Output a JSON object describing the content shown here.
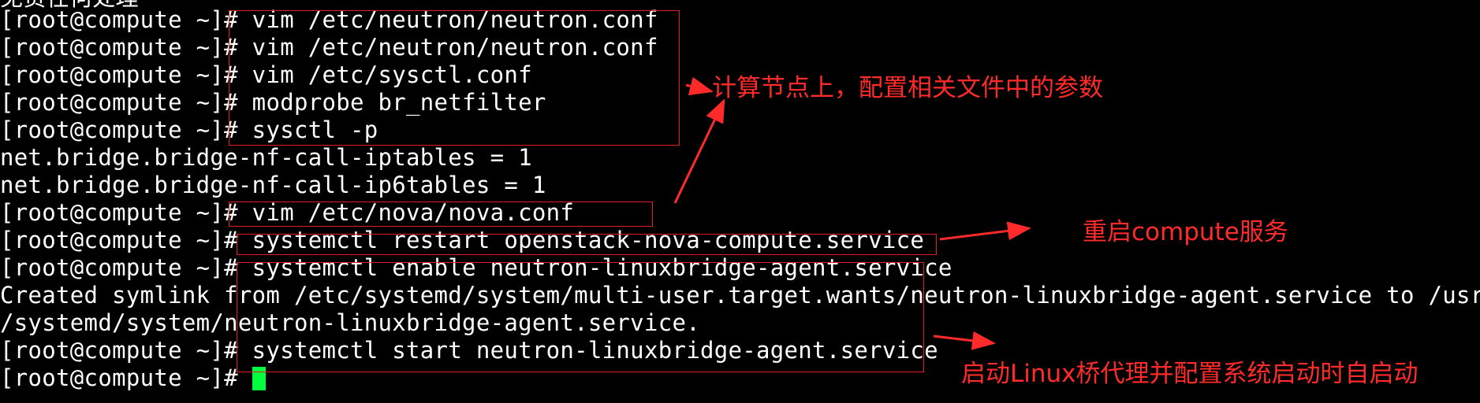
{
  "terminal": {
    "top_cut_text": "免责任何处理",
    "lines": [
      {
        "prompt": "[root@compute ~]#",
        "text": " vim /etc/neutron/neutron.conf"
      },
      {
        "prompt": "[root@compute ~]#",
        "text": " vim /etc/neutron/neutron.conf"
      },
      {
        "prompt": "[root@compute ~]#",
        "text": " vim /etc/sysctl.conf"
      },
      {
        "prompt": "[root@compute ~]#",
        "text": " modprobe br_netfilter"
      },
      {
        "prompt": "[root@compute ~]#",
        "text": " sysctl -p"
      },
      {
        "prompt": "",
        "text": "net.bridge.bridge-nf-call-iptables = 1"
      },
      {
        "prompt": "",
        "text": "net.bridge.bridge-nf-call-ip6tables = 1"
      },
      {
        "prompt": "[root@compute ~]#",
        "text": " vim /etc/nova/nova.conf"
      },
      {
        "prompt": "[root@compute ~]#",
        "text": " systemctl restart openstack-nova-compute.service"
      },
      {
        "prompt": "[root@compute ~]#",
        "text": " systemctl enable neutron-linuxbridge-agent.service"
      },
      {
        "prompt": "",
        "text": "Created symlink from /etc/systemd/system/multi-user.target.wants/neutron-linuxbridge-agent.service to /usr/lib"
      },
      {
        "prompt": "",
        "text": "/systemd/system/neutron-linuxbridge-agent.service."
      },
      {
        "prompt": "[root@compute ~]#",
        "text": " systemctl start neutron-linuxbridge-agent.service"
      },
      {
        "prompt": "[root@compute ~]#",
        "text": " "
      }
    ]
  },
  "annotations": {
    "config_note": "计算节点上，配置相关文件中的参数",
    "restart_note": "重启compute服务",
    "bridge_note": "启动Linux桥代理并配置系统启动时自启动"
  },
  "colors": {
    "background": "#000000",
    "text": "#ffffff",
    "cursor": "#00ff3c",
    "annotation": "#ff2a2a"
  }
}
